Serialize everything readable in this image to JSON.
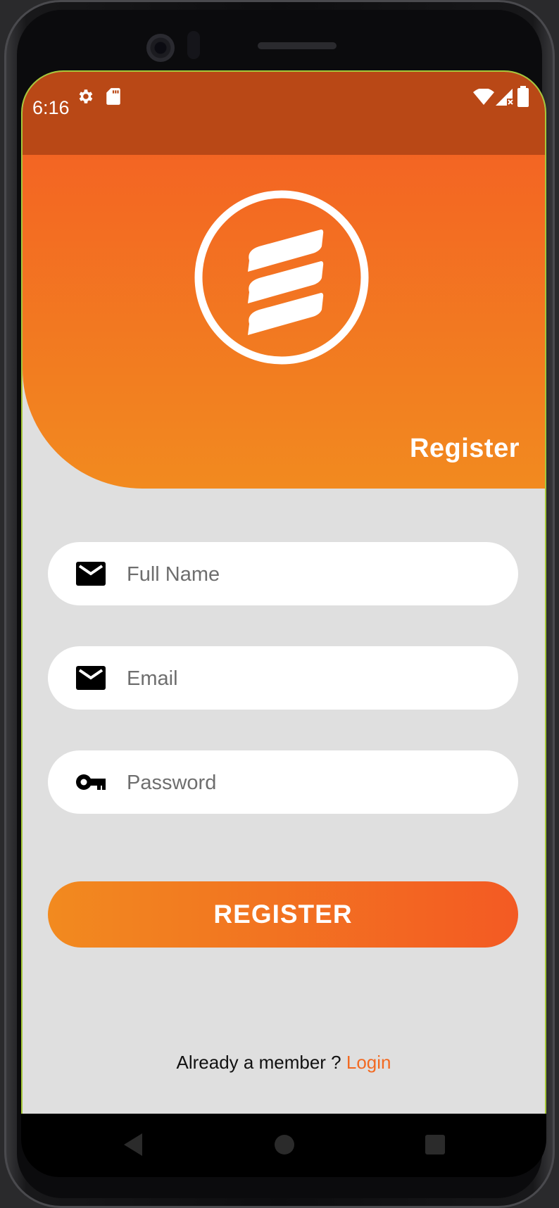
{
  "status_bar": {
    "time": "6:16",
    "icons": [
      "settings-gear-icon",
      "sd-card-icon",
      "wifi-icon",
      "cell-signal-icon",
      "battery-icon"
    ]
  },
  "header": {
    "logo": "brand-logo-icon",
    "title": "Register"
  },
  "form": {
    "full_name": {
      "placeholder": "Full Name",
      "value": "",
      "icon": "mail-icon"
    },
    "email": {
      "placeholder": "Email",
      "value": "",
      "icon": "mail-icon"
    },
    "password": {
      "placeholder": "Password",
      "value": "",
      "icon": "key-icon"
    },
    "submit_label": "REGISTER"
  },
  "footer": {
    "prompt": "Already a member ?",
    "login_link": "Login"
  },
  "nav_bar": {
    "buttons": [
      "back-icon",
      "home-icon",
      "recents-icon"
    ]
  },
  "colors": {
    "status_bar": "#b94816",
    "header_top": "#f36523",
    "header_bottom": "#f28a1f",
    "accent": "#f26a22",
    "background": "#dfdfdf"
  }
}
